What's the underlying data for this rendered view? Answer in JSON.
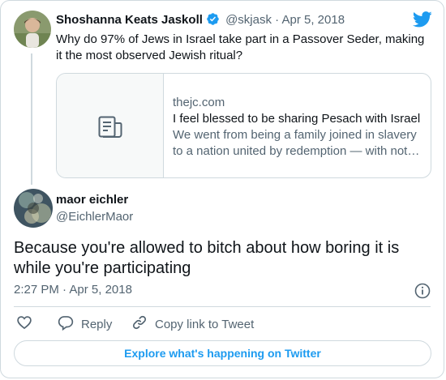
{
  "quoted_tweet": {
    "author_name": "Shoshanna Keats Jaskoll",
    "handle": "@skjask",
    "separator": "·",
    "date": "Apr 5, 2018",
    "text": "Why do 97% of Jews in Israel take part in a Passover Seder, making it the most observed Jewish ritual?",
    "link_card": {
      "domain": "thejc.com",
      "title": "I feel blessed to be sharing Pesach with Israel",
      "description": "We went from being a family joined in slavery to a nation united by redemption — with not…"
    }
  },
  "reply_tweet": {
    "author_name": "maor eichler",
    "handle": "@EichlerMaor",
    "text": "Because you're allowed to bitch about how boring it is while you're participating",
    "time": "2:27 PM",
    "separator": "·",
    "date": "Apr 5, 2018"
  },
  "actions": {
    "reply_label": "Reply",
    "copy_link_label": "Copy link to Tweet"
  },
  "explore_label": "Explore what's happening on Twitter",
  "colors": {
    "brand": "#1d9bf0",
    "text": "#0f1419",
    "muted": "#536471",
    "border": "#cfd9de"
  },
  "icons": [
    "twitter-bird-icon",
    "verified-badge-icon",
    "article-icon",
    "info-icon",
    "heart-icon",
    "reply-icon",
    "link-icon"
  ]
}
